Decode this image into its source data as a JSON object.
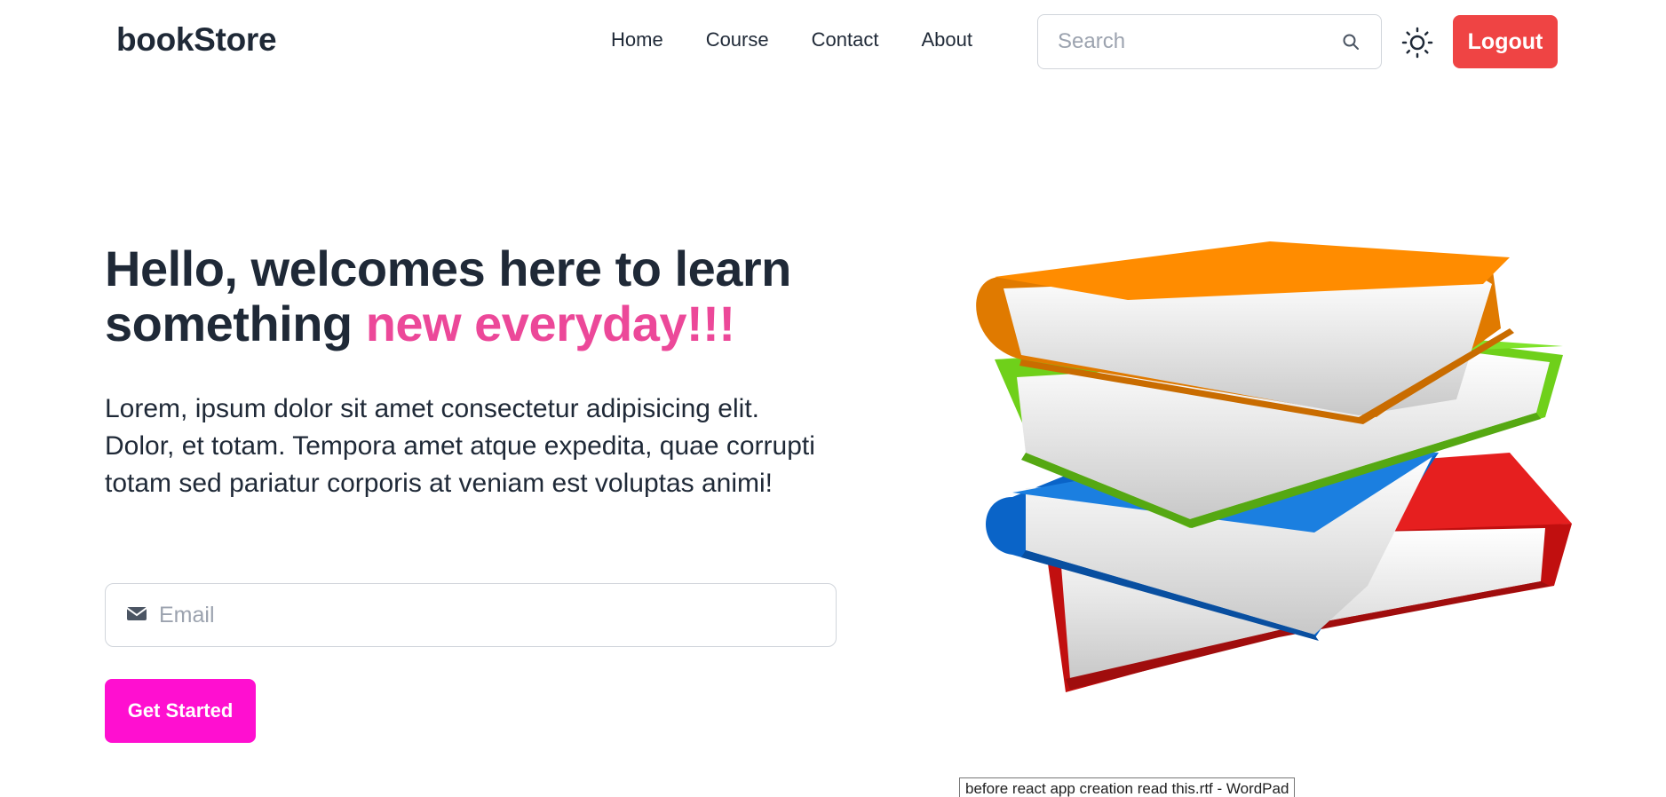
{
  "navbar": {
    "brand": "bookStore",
    "links": [
      "Home",
      "Course",
      "Contact",
      "About"
    ],
    "search": {
      "placeholder": "Search",
      "icon": "search-icon"
    },
    "theme_toggle_icon": "sun-icon",
    "logout_label": "Logout"
  },
  "hero": {
    "title_main": "Hello, welcomes here to learn something ",
    "title_accent": "new everyday!!!",
    "description": "Lorem, ipsum dolor sit amet consectetur adipisicing elit. Dolor, et totam. Tempora amet atque expedita, quae corrupti totam sed pariatur corporis at veniam est voluptas animi!",
    "email": {
      "placeholder": "Email",
      "icon": "mail-icon"
    },
    "cta_label": "Get Started",
    "image_icon": "book-stack-illustration"
  },
  "colors": {
    "logout_bg": "#ef4444",
    "accent_text": "#ec4899",
    "cta_bg": "#ff0fd0",
    "text": "#1f2937"
  },
  "taskbar_tooltip": "before react app creation read this.rtf - WordPad"
}
